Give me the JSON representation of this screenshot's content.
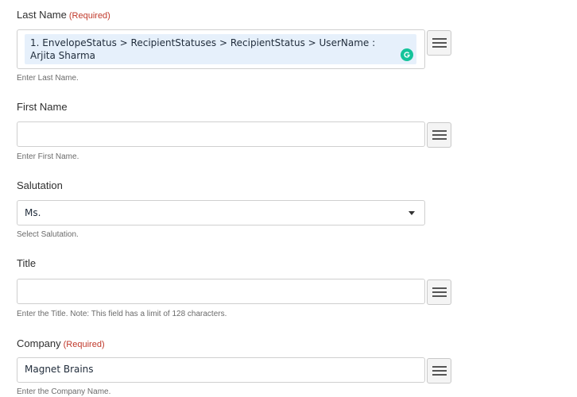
{
  "fields": {
    "last_name": {
      "label": "Last Name",
      "required": "(Required)",
      "value": "1. EnvelopeStatus > RecipientStatuses > RecipientStatus > UserName : Arjita Sharma",
      "hint": "Enter Last Name."
    },
    "first_name": {
      "label": "First Name",
      "value": "",
      "hint": "Enter First Name."
    },
    "salutation": {
      "label": "Salutation",
      "value": "Ms.",
      "hint": "Select Salutation."
    },
    "title": {
      "label": "Title",
      "value": "",
      "hint": "Enter the Title. Note: This field has a limit of 128 characters."
    },
    "company": {
      "label": "Company",
      "required": "(Required)",
      "value": "Magnet Brains",
      "hint": "Enter the Company Name."
    }
  },
  "icons": {
    "field_menu": "hamburger-menu-icon",
    "grammarly": "grammarly-icon",
    "dropdown": "chevron-down-icon"
  },
  "colors": {
    "required": "#c0392b",
    "token_bg": "#e6f0fb",
    "grammarly": "#15c39a"
  }
}
